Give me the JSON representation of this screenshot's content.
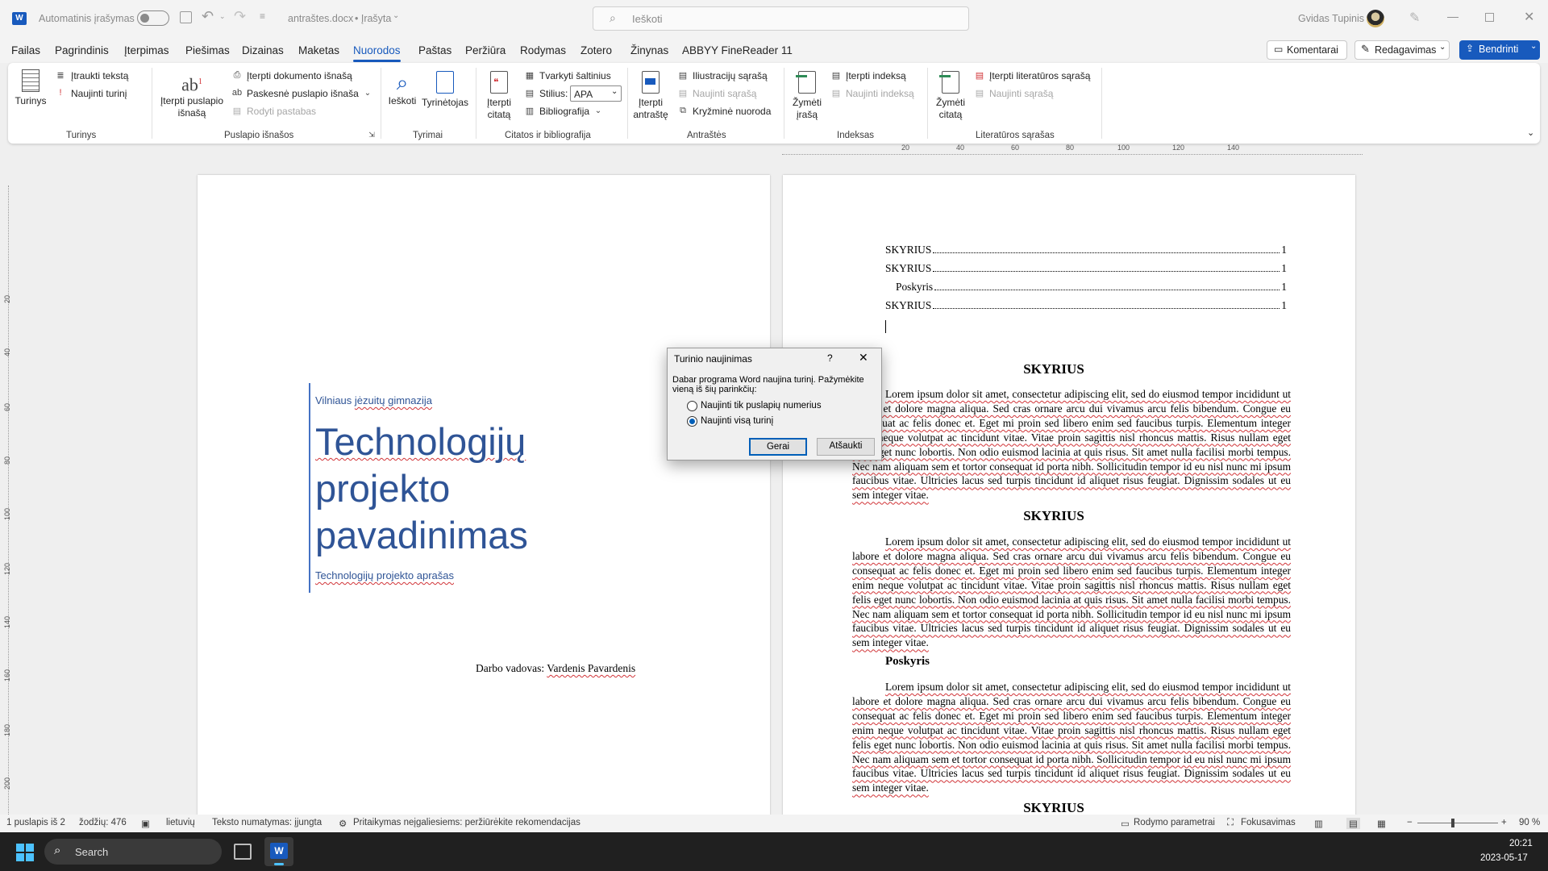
{
  "titlebar": {
    "autosave_label": "Automatinis įrašymas",
    "filename": "antraštes.docx",
    "saved_state": "• Įrašyta",
    "search_placeholder": "Ieškoti",
    "user_name": "Gvidas Tupinis"
  },
  "tabs": [
    "Failas",
    "Pagrindinis",
    "Įterpimas",
    "Piešimas",
    "Dizainas",
    "Maketas",
    "Nuorodos",
    "Paštas",
    "Peržiūra",
    "Rodymas",
    "Zotero",
    "Žinynas",
    "ABBYY FineReader 11"
  ],
  "active_tab": "Nuorodos",
  "header_buttons": {
    "comments": "Komentarai",
    "editing": "Redagavimas",
    "share": "Bendrinti"
  },
  "ribbon": {
    "toc": {
      "big": "Turinys",
      "add_text": "Įtraukti tekstą",
      "update": "Naujinti turinį",
      "group": "Turinys"
    },
    "footnotes": {
      "insert_big_1": "Įterpti puslapio",
      "insert_big_2": "išnašą",
      "insert_endnote": "Įterpti dokumento išnašą",
      "next_footnote": "Paskesnė puslapio išnaša",
      "show_notes": "Rodyti pastabas",
      "group": "Puslapio išnašos"
    },
    "research": {
      "search": "Ieškoti",
      "researcher": "Tyrinėtojas",
      "group": "Tyrimai"
    },
    "citations": {
      "insert_big_1": "Įterpti",
      "insert_big_2": "citatą",
      "manage": "Tvarkyti šaltinius",
      "style_label": "Stilius:",
      "style_value": "APA",
      "bibliography": "Bibliografija",
      "group": "Citatos ir bibliografija"
    },
    "captions": {
      "insert_big_1": "Įterpti",
      "insert_big_2": "antraštę",
      "table_of_figures": "Iliustracijų sąrašą",
      "update_table": "Naujinti sąrašą",
      "cross_ref": "Kryžminė nuoroda",
      "group": "Antraštės"
    },
    "index": {
      "mark_1": "Žymėti",
      "mark_2": "įrašą",
      "insert": "Įterpti indeksą",
      "update": "Naujinti indeksą",
      "group": "Indeksas"
    },
    "toa": {
      "mark_1": "Žymėti",
      "mark_2": "citatą",
      "insert": "Įterpti literatūros sąrašą",
      "update": "Naujinti sąrašą",
      "group": "Literatūros sąrašas"
    }
  },
  "page1": {
    "school": [
      "Vilniaus ",
      "jėzuitų gimnazija"
    ],
    "title_lines": [
      "Technologijų",
      "projekto",
      "pavadinimas"
    ],
    "subtitle": "Technologijų projekto aprašas",
    "supervisor_label": "Darbo vadovas: ",
    "supervisor_name": "Vardenis Pavardenis"
  },
  "page2": {
    "toc": [
      {
        "text": "SKYRIUS",
        "page": "1",
        "indent": false
      },
      {
        "text": "SKYRIUS",
        "page": "1",
        "indent": false
      },
      {
        "text": "Poskyris",
        "page": "1",
        "indent": true
      },
      {
        "text": "SKYRIUS",
        "page": "1",
        "indent": false
      }
    ],
    "heading_1": "SKYRIUS",
    "heading_2": "SKYRIUS",
    "subheading": "Poskyris",
    "heading_3": "SKYRIUS",
    "lorem": "Lorem ipsum dolor sit amet, consectetur adipiscing elit, sed do eiusmod tempor incididunt ut labore et dolore magna aliqua. Sed cras ornare arcu dui vivamus arcu felis bibendum. Congue eu consequat ac felis donec et. Eget mi proin sed libero enim sed faucibus turpis. Elementum integer enim neque volutpat ac tincidunt vitae. Vitae proin sagittis nisl rhoncus mattis. Risus nullam eget felis eget nunc lobortis. Non odio euismod lacinia at quis risus. Sit amet nulla facilisi morbi tempus. Nec nam aliquam sem et tortor consequat id porta nibh. Sollicitudin tempor id eu nisl nunc mi ipsum faucibus vitae. Ultricies lacus sed turpis tincidunt id aliquet risus feugiat. Dignissim sodales ut eu sem integer vitae."
  },
  "dialog": {
    "title": "Turinio naujinimas",
    "help": "?",
    "message": "Dabar programa Word naujina turinį. Pažymėkite vieną iš šių parinkčių:",
    "option_1": "Naujinti tik puslapių numerius",
    "option_2": "Naujinti visą turinį",
    "selected_option": 2,
    "ok": "Gerai",
    "cancel": "Atšaukti"
  },
  "statusbar": {
    "page": "1 puslapis iš 2",
    "words": "žodžių: 476",
    "language": "lietuvių",
    "text_prediction": "Teksto numatymas: įjungta",
    "accessibility": "Pritaikymas neįgaliesiems: peržiūrėkite rekomendacijas",
    "display_settings": "Rodymo parametrai",
    "focus": "Fokusavimas",
    "zoom": "90 %"
  },
  "taskbar": {
    "search": "Search",
    "time": "20:21",
    "date": "2023-05-17"
  },
  "ruler": {
    "h_ticks": [
      "20",
      "40",
      "60",
      "80",
      "100",
      "120",
      "140"
    ],
    "v_ticks": [
      "20",
      "40",
      "60",
      "80",
      "100",
      "120",
      "140",
      "160",
      "180",
      "200"
    ]
  },
  "colors": {
    "accent": "#185abd",
    "title_blue": "#2f5496",
    "page_bg": "#ffffff",
    "canvas_bg": "#efefef",
    "spell_error": "#d13438"
  }
}
